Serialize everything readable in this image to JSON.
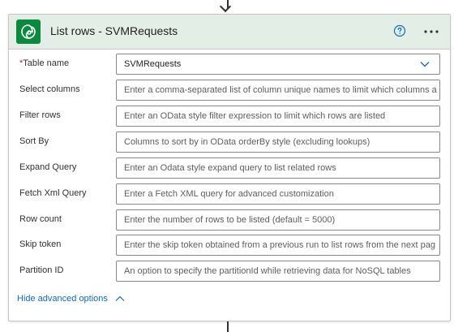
{
  "card": {
    "title": "List rows - SVMRequests",
    "help_icon": "help-circle-icon",
    "more_icon": "more-dots-icon",
    "app_icon": "dataverse-icon",
    "accent": "#0b8a3f",
    "header_bg": "#e3eee7"
  },
  "fields": [
    {
      "label": "Table name",
      "required": "*",
      "value": "SVMRequests",
      "placeholder": ""
    },
    {
      "label": "Select columns",
      "placeholder": "Enter a comma-separated list of column unique names to limit which columns a"
    },
    {
      "label": "Filter rows",
      "placeholder": "Enter an OData style filter expression to limit which rows are listed"
    },
    {
      "label": "Sort By",
      "placeholder": "Columns to sort by in OData orderBy style (excluding lookups)"
    },
    {
      "label": "Expand Query",
      "placeholder": "Enter an Odata style expand query to list related rows"
    },
    {
      "label": "Fetch Xml Query",
      "placeholder": "Enter a Fetch XML query for advanced customization"
    },
    {
      "label": "Row count",
      "placeholder": "Enter the number of rows to be listed (default = 5000)"
    },
    {
      "label": "Skip token",
      "placeholder": "Enter the skip token obtained from a previous run to list rows from the next pag"
    },
    {
      "label": "Partition ID",
      "placeholder": "An option to specify the partitionId while retrieving data for NoSQL tables"
    }
  ],
  "footer": {
    "hide_advanced": "Hide advanced options"
  }
}
